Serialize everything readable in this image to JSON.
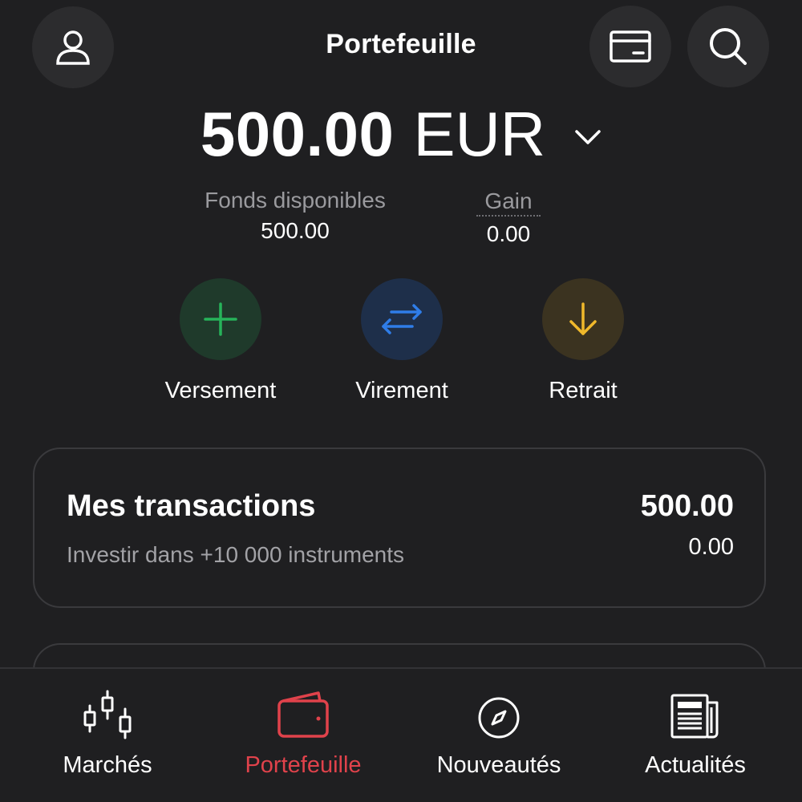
{
  "header": {
    "title": "Portefeuille"
  },
  "balance": {
    "amount": "500.00",
    "currency": "EUR"
  },
  "stats": {
    "funds_label": "Fonds disponibles",
    "funds_value": "500.00",
    "gain_label": "Gain",
    "gain_value": "0.00"
  },
  "actions": {
    "deposit_label": "Versement",
    "transfer_label": "Virement",
    "withdraw_label": "Retrait"
  },
  "transactions": {
    "title": "Mes transactions",
    "subtitle": "Investir dans +10 000 instruments",
    "amount": "500.00",
    "secondary_amount": "0.00"
  },
  "bottom_nav": {
    "items": [
      {
        "label": "Marchés",
        "icon": "candlestick-icon"
      },
      {
        "label": "Portefeuille",
        "icon": "wallet-icon"
      },
      {
        "label": "Nouveautés",
        "icon": "compass-icon"
      },
      {
        "label": "Actualités",
        "icon": "newspaper-icon"
      }
    ]
  },
  "colors": {
    "background": "#1f1f21",
    "active_nav": "#e0424b",
    "deposit_green": "#27b35a",
    "transfer_blue": "#2f7de8",
    "withdraw_yellow": "#f0b92b"
  }
}
